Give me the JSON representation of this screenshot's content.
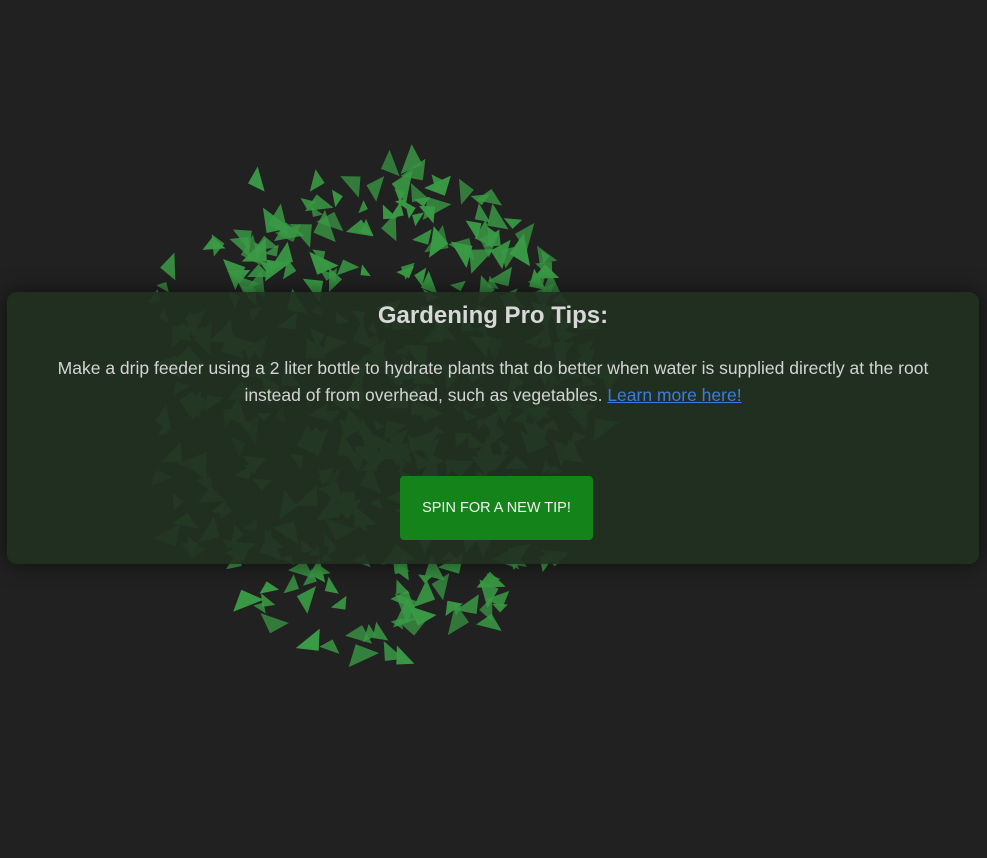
{
  "panel": {
    "title": "Gardening Pro Tips:",
    "tip_text": "Make a drip feeder using a 2 liter bottle to hydrate plants that do better when water is supplied directly at the root instead of from overhead, such as vegetables.",
    "link_label": "Learn more here!",
    "button_label": "SPIN FOR A NEW TIP!"
  },
  "colors": {
    "background": "#212121",
    "leaf": "#3a9a45",
    "button": "#14841a",
    "link": "#3d7be0"
  },
  "decoration": {
    "icon": "leaf-triangle-icon"
  }
}
